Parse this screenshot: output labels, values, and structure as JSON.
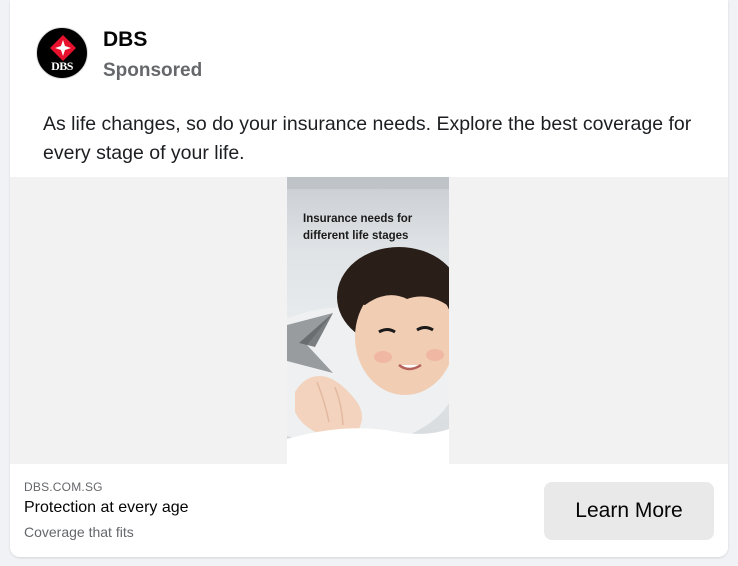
{
  "post": {
    "page_name": "DBS",
    "sponsored_label": "Sponsored",
    "logo_text": "DBS",
    "body": "As life changes, so do your insurance needs. Explore the best coverage for every stage of your life."
  },
  "ad_image": {
    "headline": "Insurance needs for different life stages"
  },
  "footer": {
    "domain": "DBS.COM.SG",
    "title": "Protection at every age",
    "description": "Coverage that fits",
    "cta_label": "Learn More"
  },
  "colors": {
    "brand_red": "#e8112d",
    "logo_background": "#000000",
    "muted_text": "#65676b",
    "cta_background": "#e9e9e9"
  },
  "icons": {
    "logo": "dbs-star-logo-icon",
    "decor": "dbs-x-mark-icon"
  }
}
